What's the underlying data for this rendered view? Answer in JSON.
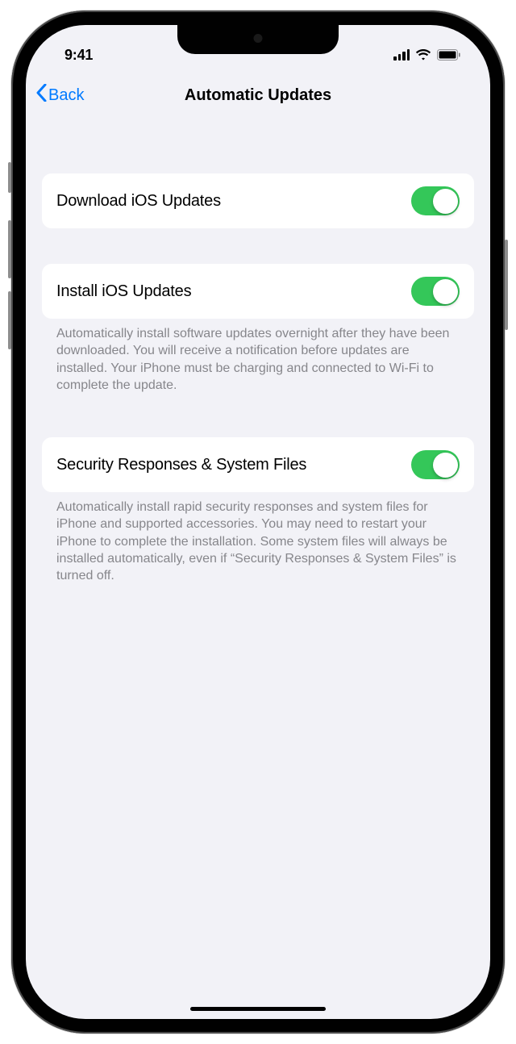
{
  "status": {
    "time": "9:41"
  },
  "nav": {
    "back_label": "Back",
    "title": "Automatic Updates"
  },
  "settings": {
    "download": {
      "label": "Download iOS Updates",
      "enabled": true
    },
    "install": {
      "label": "Install iOS Updates",
      "enabled": true,
      "footer": "Automatically install software updates overnight after they have been downloaded. You will receive a notification before updates are installed. Your iPhone must be charging and connected to Wi-Fi to complete the update."
    },
    "security": {
      "label": "Security Responses & System Files",
      "enabled": true,
      "footer": "Automatically install rapid security responses and system files for iPhone and supported accessories. You may need to restart your iPhone to complete the installation. Some system files will always be installed automatically, even if “Security Responses & System Files” is turned off."
    }
  },
  "colors": {
    "accent": "#007aff",
    "switch_on": "#34c759",
    "background": "#f2f2f7",
    "secondary_text": "#86868b"
  }
}
